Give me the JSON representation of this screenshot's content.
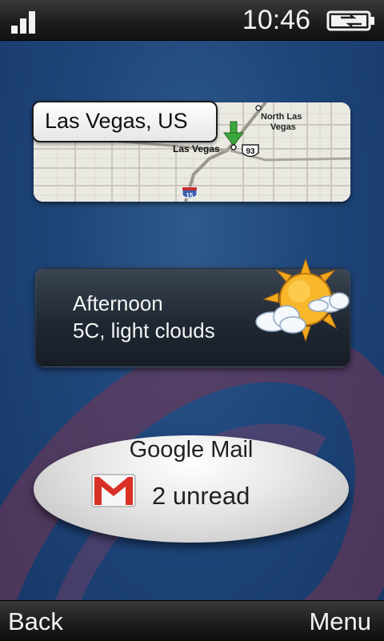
{
  "status": {
    "time": "10:46",
    "signal_icon": "signal-bars-icon",
    "battery_icon": "battery-charging-icon"
  },
  "map_widget": {
    "location": "Las Vegas, US",
    "labels": {
      "city": "Las Vegas",
      "north_line1": "North Las",
      "north_line2": "Vegas",
      "route_93": "93",
      "route_15": "15"
    }
  },
  "weather": {
    "period": "Afternoon",
    "conditions": "5C, light clouds",
    "icon": "sun-with-clouds-icon"
  },
  "mail": {
    "title": "Google Mail",
    "unread": "2 unread",
    "icon": "gmail-icon",
    "accent": "#d93025"
  },
  "softkeys": {
    "left": "Back",
    "right": "Menu"
  }
}
